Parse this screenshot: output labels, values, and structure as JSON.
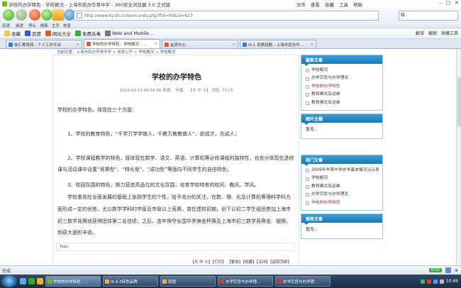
{
  "window": {
    "title": "学校的办学特色 - 学校概况 - 上海市民办华育中学 - 360安全浏览器 3.0 正式版",
    "menu": [
      "文件",
      "查看",
      "收藏",
      "工具",
      "帮助"
    ]
  },
  "nav": {
    "buttons": [
      "后退",
      "前进",
      "停止",
      "刷新",
      "主页",
      "恢复"
    ],
    "address": "http://www.hy.sh.cn/bencandy.php?fid=40&id=623"
  },
  "favorites": {
    "items": [
      "收藏",
      "百度",
      "网址大全",
      "免费杀毒",
      "Web and Mobile..."
    ],
    "right": [
      "翻译",
      "截图",
      "收藏工具"
    ]
  },
  "tabs": [
    {
      "label": "徐汇教育网 - 个人工作平台"
    },
    {
      "label": "学校的办学特色 - 学校概况 - ..."
    },
    {
      "label": "会员中心"
    },
    {
      "label": "III-1 发展战略 - 上海市民办华..."
    }
  ],
  "breadcrumb": "当前位置：上海市民办华育中学 > 信息公开 > 学校概况 > 学校概况",
  "article": {
    "title": "学校的办学特色",
    "meta": "2010-03-19 06:59:56 来源： 作者： 【大 中 小】 浏览: 721次",
    "paragraphs": [
      "学校的办学特色，体现在三个方面：",
      "1、学校的教育特色，“千学万学学做人，千教万教教做人”，欲成才，先成人；",
      "2、学校课程教学的特色，既体现在数学、语文、英语、计算机等必修课程的独特性，也充分体现在选修课与活动课中设置“竞赛型”、“特长型”、“成功型”等面向不同学生的自由特色；",
      "3、校园氛围的特色，努力营造高品位的文化氛围，培育学校特有的校风、教风、学风。",
      "学校重视在全面发展的基础上张扬学生的个性，给予充分的关注，在数、理、化及计算机等理科学科方面形成一定的优势，尤以数学学科的市级及市级以上竞赛，曾在建校初期，创下以初二学生组团参加上海市初三数学竞赛就获得团体第二名佳绩；之后，连年保夺全国华罗庚金杯赛及上海市初三数学竞赛金、银牌，频获大面积丰收。"
    ],
    "tags": "Tags:",
    "footer": "【大 中 小】【打印】 【繁体】【收藏】【关闭】【返回顶部】"
  },
  "sidebar": {
    "latest": {
      "title": "最新文章",
      "items": [
        "学校概况",
        "办学宗旨与办学理念",
        "学校的办学特色",
        "教育模式及运维",
        "教育模式及运维"
      ],
      "highlight": 2
    },
    "pictures": {
      "title": "图片主题",
      "text": "暂无..."
    },
    "hot": {
      "title": "热门文章",
      "items": [
        "2009年华育中学办学基本情况公示表",
        "学校概况",
        "教育模式及运维",
        "办学宗旨与办学理念",
        "学校的办学特色"
      ],
      "highlight": 4
    },
    "recommended": {
      "title": "推荐文章",
      "text": "暂无..."
    }
  },
  "status": {
    "text": "完成",
    "downloads": "0/16"
  },
  "taskbar": {
    "windows": [
      "学校的办学特色 - ...",
      "III 4-2特色品牌",
      "原图",
      "办学宗旨与办学理...",
      "办学宗旨与办学理..."
    ],
    "active": 0,
    "clock": "10:49"
  },
  "colors": {
    "accent": "#1a78b4",
    "highlight": "#a0195f"
  }
}
